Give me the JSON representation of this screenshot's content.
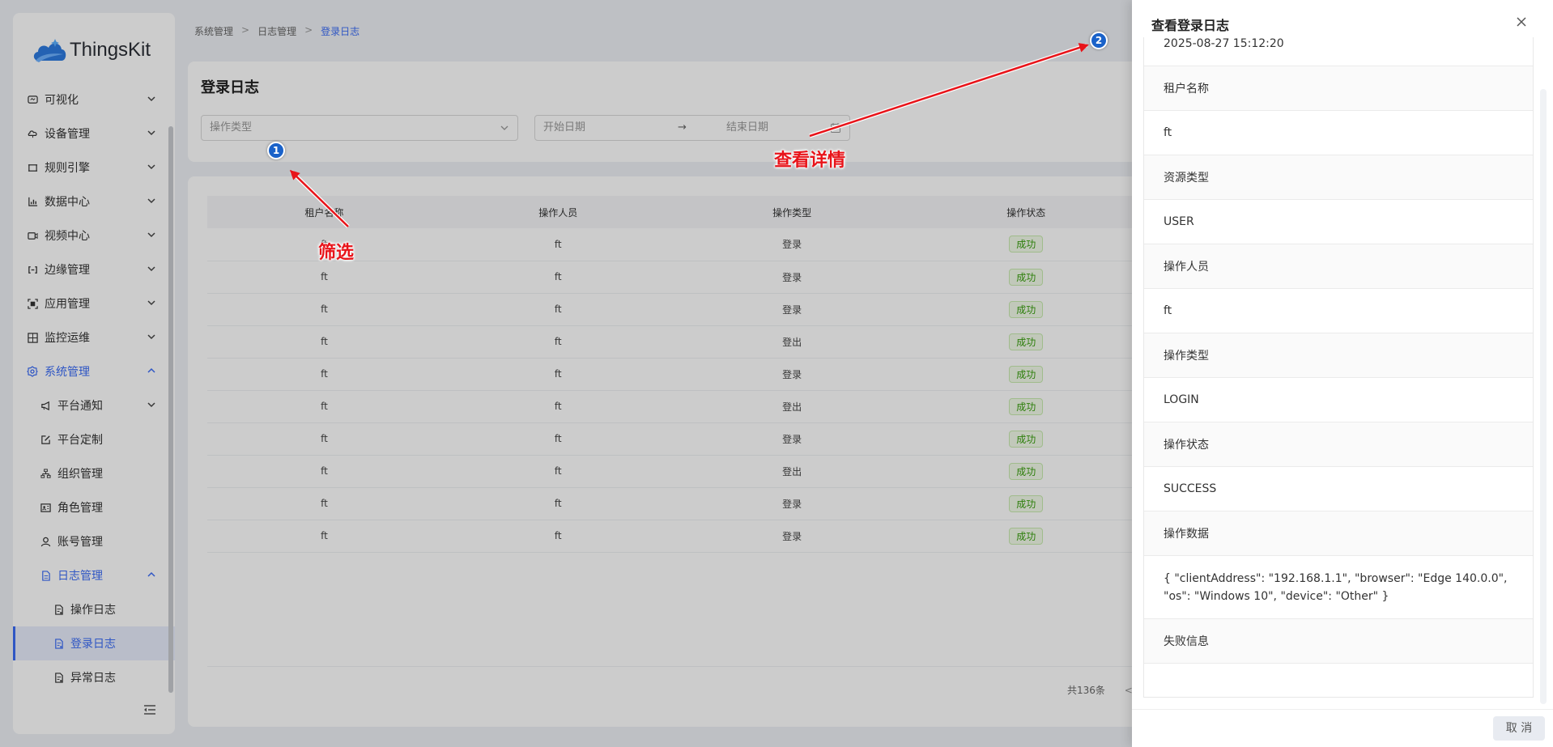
{
  "app": {
    "name": "ThingsKit"
  },
  "sidebar": {
    "items": [
      {
        "label": "可视化",
        "icon": "visual-icon",
        "level": 1,
        "expanded": false
      },
      {
        "label": "设备管理",
        "icon": "device-icon",
        "level": 1,
        "expanded": false
      },
      {
        "label": "规则引擎",
        "icon": "rule-icon",
        "level": 1,
        "expanded": false
      },
      {
        "label": "数据中心",
        "icon": "chart-icon",
        "level": 1,
        "expanded": false
      },
      {
        "label": "视频中心",
        "icon": "video-icon",
        "level": 1,
        "expanded": false
      },
      {
        "label": "边缘管理",
        "icon": "edge-icon",
        "level": 1,
        "expanded": false
      },
      {
        "label": "应用管理",
        "icon": "app-icon",
        "level": 1,
        "expanded": false
      },
      {
        "label": "监控运维",
        "icon": "monitor-icon",
        "level": 1,
        "expanded": false
      },
      {
        "label": "系统管理",
        "icon": "gear-icon",
        "level": 1,
        "expanded": true
      },
      {
        "label": "平台通知",
        "icon": "megaphone-icon",
        "level": 2,
        "expanded": false
      },
      {
        "label": "平台定制",
        "icon": "edit-icon",
        "level": 2
      },
      {
        "label": "组织管理",
        "icon": "org-icon",
        "level": 2
      },
      {
        "label": "角色管理",
        "icon": "role-icon",
        "level": 2
      },
      {
        "label": "账号管理",
        "icon": "user-icon",
        "level": 2
      },
      {
        "label": "日志管理",
        "icon": "file-icon",
        "level": 2,
        "expanded": true
      },
      {
        "label": "操作日志",
        "icon": "log-icon",
        "level": 3
      },
      {
        "label": "登录日志",
        "icon": "log-icon",
        "level": 3,
        "selected": true
      },
      {
        "label": "异常日志",
        "icon": "log-icon",
        "level": 3
      }
    ]
  },
  "breadcrumb": {
    "items": [
      "系统管理",
      "日志管理",
      "登录日志"
    ],
    "separator": ">"
  },
  "page": {
    "title": "登录日志",
    "filter": {
      "type_placeholder": "操作类型",
      "start_placeholder": "开始日期",
      "end_placeholder": "结束日期",
      "range_arrow": "→"
    }
  },
  "table": {
    "columns": [
      "租户名称",
      "操作人员",
      "操作类型",
      "操作状态"
    ],
    "rows": [
      [
        "ft",
        "ft",
        "登录",
        "成功"
      ],
      [
        "ft",
        "ft",
        "登录",
        "成功"
      ],
      [
        "ft",
        "ft",
        "登录",
        "成功"
      ],
      [
        "ft",
        "ft",
        "登出",
        "成功"
      ],
      [
        "ft",
        "ft",
        "登录",
        "成功"
      ],
      [
        "ft",
        "ft",
        "登出",
        "成功"
      ],
      [
        "ft",
        "ft",
        "登录",
        "成功"
      ],
      [
        "ft",
        "ft",
        "登出",
        "成功"
      ],
      [
        "ft",
        "ft",
        "登录",
        "成功"
      ],
      [
        "ft",
        "ft",
        "登录",
        "成功"
      ]
    ],
    "total_label": "共136条",
    "prev_label": "<"
  },
  "annotations": {
    "filter_callout": "筛选",
    "detail_callout": "查看详情",
    "step1": "1",
    "step2": "2",
    "arrow_color": "#e8141a"
  },
  "drawer": {
    "title": "查看登录日志",
    "close_icon": "close-icon",
    "fields": [
      {
        "label": null,
        "value": "2025-08-27 15:12:20"
      },
      {
        "label": "租户名称",
        "value": "ft"
      },
      {
        "label": "资源类型",
        "value": "USER"
      },
      {
        "label": "操作人员",
        "value": "ft"
      },
      {
        "label": "操作类型",
        "value": "LOGIN"
      },
      {
        "label": "操作状态",
        "value": "SUCCESS"
      },
      {
        "label": "操作数据",
        "value": "{ \"clientAddress\": \"192.168.1.1\", \"browser\": \"Edge 140.0.0\", \"os\": \"Windows 10\", \"device\": \"Other\" }"
      },
      {
        "label": "失败信息",
        "value": ""
      }
    ],
    "cancel_label": "取 消"
  },
  "colors": {
    "accent": "#3b6cf6",
    "success": "#389e0d",
    "annotation": "#e8141a",
    "step_dot": "#1a62c9"
  }
}
